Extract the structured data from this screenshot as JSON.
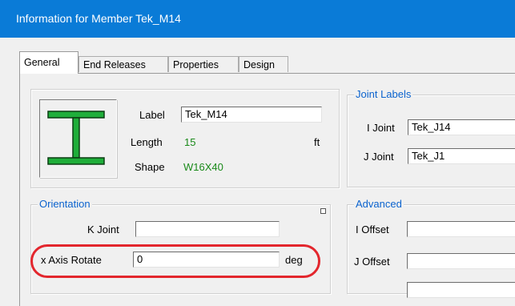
{
  "window": {
    "title": "Information for Member Tek_M14"
  },
  "tabs": [
    "General",
    "End Releases",
    "Properties",
    "Design"
  ],
  "member": {
    "label_caption": "Label",
    "label_value": "Tek_M14",
    "length_caption": "Length",
    "length_value": "15",
    "length_unit": "ft",
    "shape_caption": "Shape",
    "shape_value": "W16X40",
    "icon": "i-beam-icon"
  },
  "joint_labels": {
    "legend": "Joint Labels",
    "i_joint_caption": "I Joint",
    "i_joint_value": "Tek_J14",
    "j_joint_caption": "J Joint",
    "j_joint_value": "Tek_J1"
  },
  "orientation": {
    "legend": "Orientation",
    "k_joint_caption": "K Joint",
    "k_joint_value": "",
    "x_axis_rotate_caption": "x Axis Rotate",
    "x_axis_rotate_value": "0",
    "x_axis_rotate_unit": "deg"
  },
  "advanced": {
    "legend": "Advanced",
    "i_offset_caption": "I Offset",
    "i_offset_value": "",
    "j_offset_caption": "J Offset",
    "j_offset_value": ""
  },
  "colors": {
    "title_bar": "#0a7bd7",
    "legend_text": "#0b63ce",
    "value_text": "#1a8a1a",
    "icon_green": "#1fae3a",
    "highlight": "#e3262d"
  }
}
